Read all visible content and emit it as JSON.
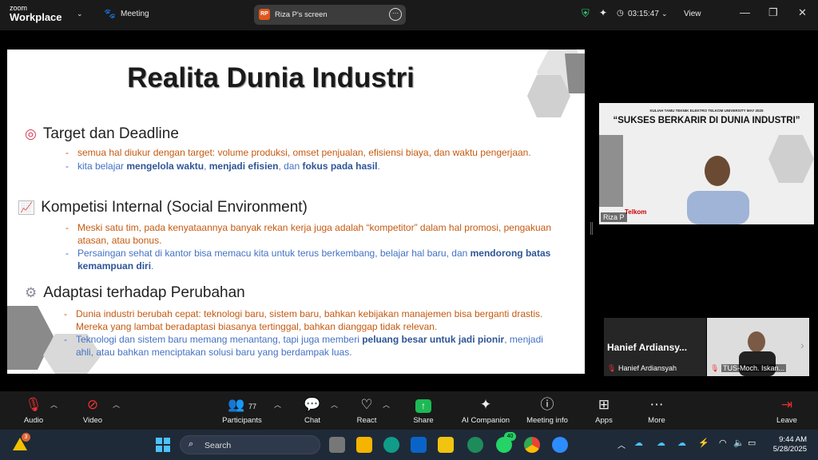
{
  "app": {
    "brand_line1": "zoom",
    "brand_line2": "Workplace",
    "meeting_label": "Meeting",
    "share_label": "Riza P's screen",
    "share_initials": "RP",
    "timer": "03:15:47",
    "view_label": "View"
  },
  "slide": {
    "title": "Realita Dunia Industri",
    "sections": [
      {
        "heading": "Target dan Deadline",
        "icon": "target-icon"
      },
      {
        "heading": "Kompetisi Internal (Social Environment)",
        "icon": "chart-icon"
      },
      {
        "heading": "Adaptasi terhadap Perubahan",
        "icon": "gear-icon"
      }
    ],
    "s1b1": "semua hal diukur dengan target: volume produksi, omset penjualan, efisiensi biaya, dan waktu pengerjaan.",
    "s1b2_a": "kita belajar ",
    "s1b2_b": "mengelola waktu",
    "s1b2_c": ", ",
    "s1b2_d": "menjadi efisien",
    "s1b2_e": ", dan ",
    "s1b2_f": "fokus pada hasil",
    "s1b2_g": ".",
    "s2b1": "Meski satu tim, pada kenyataannya banyak rekan kerja juga adalah “kompetitor” dalam hal promosi, pengakuan atasan, atau bonus.",
    "s2b2_a": "Persaingan sehat di kantor bisa memacu kita untuk terus berkembang, belajar hal baru, dan ",
    "s2b2_b": "mendorong batas kemampuan diri",
    "s2b2_c": ".",
    "s3b1": "Dunia industri berubah cepat: teknologi baru, sistem baru, bahkan kebijakan manajemen bisa berganti drastis. Mereka yang lambat beradaptasi biasanya tertinggal, bahkan dianggap tidak relevan.",
    "s3b2_a": "Teknologi dan sistem baru memang menantang, tapi juga memberi ",
    "s3b2_b": "peluang besar untuk jadi pionir",
    "s3b2_c": ", menjadi ahli, atau bahkan menciptakan solusi baru yang berdampak luas."
  },
  "speaker": {
    "banner_small": "KULIAH TAMU TEKNIK ELEKTRO TELKOM UNIVERSITY MAY 2025",
    "banner_big": "“SUKSES BERKARIR DI DUNIA INDUSTRI”",
    "name": "Riza P",
    "logo_text": "Telkom"
  },
  "tiles": [
    {
      "big": "Hanief Ardiansy...",
      "label": "Hanief Ardiansyah"
    },
    {
      "label": "TUS-Moch. Iskan..."
    }
  ],
  "toolbar": {
    "audio": "Audio",
    "video": "Video",
    "participants": "Participants",
    "participants_count": "77",
    "chat": "Chat",
    "react": "React",
    "share": "Share",
    "ai": "AI Companion",
    "info": "Meeting info",
    "apps": "Apps",
    "more": "More",
    "leave": "Leave"
  },
  "taskbar": {
    "search": "Search",
    "time": "9:44 AM",
    "date": "5/28/2025",
    "whatsapp_badge": "40",
    "notif_badge": "3"
  },
  "colors": {
    "orange_text": "#c55a11",
    "blue_text": "#4472c4",
    "share_green": "#1db954",
    "leave_red": "#e02f2f"
  }
}
